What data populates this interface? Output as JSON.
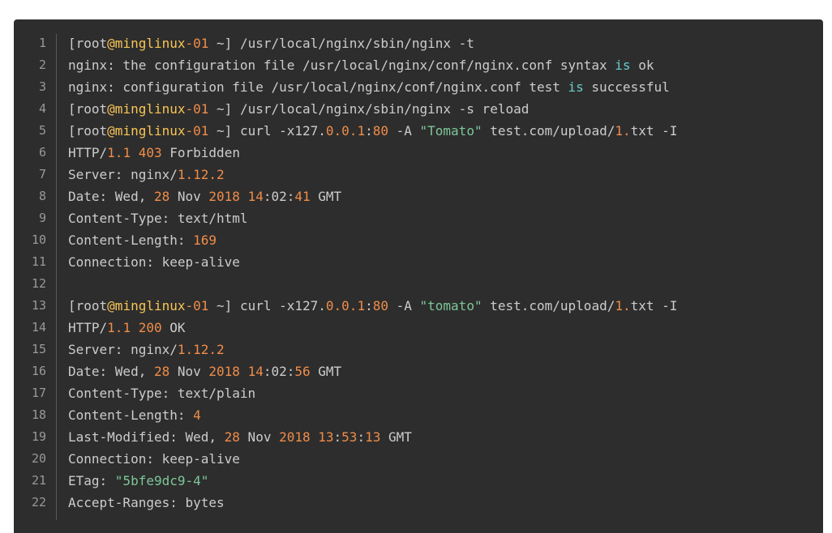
{
  "colors": {
    "background": "#2d2d2d",
    "default_text": "#cccccc",
    "line_number": "#999999",
    "number": "#f08d49",
    "string": "#7ec699",
    "at_symbol": "#f8c555",
    "keyword_is": "#67cdcc"
  },
  "code": {
    "lines": [
      {
        "n": "1",
        "tokens": [
          [
            "[root",
            "d"
          ],
          [
            "@minglinux",
            "a"
          ],
          [
            "-01",
            "p"
          ],
          [
            " ~] /usr/local/nginx/sbin/nginx -t",
            "d"
          ]
        ]
      },
      {
        "n": "2",
        "tokens": [
          [
            "nginx: the configuration file /usr/local/nginx/conf/nginx.conf syntax ",
            "d"
          ],
          [
            "is",
            "c"
          ],
          [
            " ok",
            "d"
          ]
        ]
      },
      {
        "n": "3",
        "tokens": [
          [
            "nginx: configuration file /usr/local/nginx/conf/nginx.conf test ",
            "d"
          ],
          [
            "is",
            "c"
          ],
          [
            " successful",
            "d"
          ]
        ]
      },
      {
        "n": "4",
        "tokens": [
          [
            "[root",
            "d"
          ],
          [
            "@minglinux",
            "a"
          ],
          [
            "-01",
            "p"
          ],
          [
            " ~] /usr/local/nginx/sbin/nginx -s reload",
            "d"
          ]
        ]
      },
      {
        "n": "5",
        "tokens": [
          [
            "[root",
            "d"
          ],
          [
            "@minglinux",
            "a"
          ],
          [
            "-01",
            "p"
          ],
          [
            " ~] curl -x127.",
            "d"
          ],
          [
            "0.0.1",
            "p"
          ],
          [
            ":",
            "d"
          ],
          [
            "80",
            "p"
          ],
          [
            " -A ",
            "d"
          ],
          [
            "\"Tomato\"",
            "s"
          ],
          [
            " test.com/upload/",
            "d"
          ],
          [
            "1.",
            "p"
          ],
          [
            "txt -I",
            "d"
          ]
        ]
      },
      {
        "n": "6",
        "tokens": [
          [
            "HTTP/",
            "d"
          ],
          [
            "1.1",
            "p"
          ],
          [
            " ",
            "d"
          ],
          [
            "403",
            "p"
          ],
          [
            " Forbidden",
            "d"
          ]
        ]
      },
      {
        "n": "7",
        "tokens": [
          [
            "Server: nginx/",
            "d"
          ],
          [
            "1.12.2",
            "p"
          ]
        ]
      },
      {
        "n": "8",
        "tokens": [
          [
            "Date: Wed, ",
            "d"
          ],
          [
            "28",
            "p"
          ],
          [
            " Nov ",
            "d"
          ],
          [
            "2018",
            "p"
          ],
          [
            " ",
            "d"
          ],
          [
            "14",
            "p"
          ],
          [
            ":02:",
            "d"
          ],
          [
            "41",
            "p"
          ],
          [
            " GMT",
            "d"
          ]
        ]
      },
      {
        "n": "9",
        "tokens": [
          [
            "Content-Type: text/html",
            "d"
          ]
        ]
      },
      {
        "n": "10",
        "tokens": [
          [
            "Content-Length: ",
            "d"
          ],
          [
            "169",
            "p"
          ]
        ]
      },
      {
        "n": "11",
        "tokens": [
          [
            "Connection: keep-alive",
            "d"
          ]
        ]
      },
      {
        "n": "12",
        "tokens": []
      },
      {
        "n": "13",
        "tokens": [
          [
            "[root",
            "d"
          ],
          [
            "@minglinux",
            "a"
          ],
          [
            "-01",
            "p"
          ],
          [
            " ~] curl -x127.",
            "d"
          ],
          [
            "0.0.1",
            "p"
          ],
          [
            ":",
            "d"
          ],
          [
            "80",
            "p"
          ],
          [
            " -A ",
            "d"
          ],
          [
            "\"tomato\"",
            "s"
          ],
          [
            " test.com/upload/",
            "d"
          ],
          [
            "1.",
            "p"
          ],
          [
            "txt -I",
            "d"
          ]
        ]
      },
      {
        "n": "14",
        "tokens": [
          [
            "HTTP/",
            "d"
          ],
          [
            "1.1",
            "p"
          ],
          [
            " ",
            "d"
          ],
          [
            "200",
            "p"
          ],
          [
            " OK",
            "d"
          ]
        ]
      },
      {
        "n": "15",
        "tokens": [
          [
            "Server: nginx/",
            "d"
          ],
          [
            "1.12.2",
            "p"
          ]
        ]
      },
      {
        "n": "16",
        "tokens": [
          [
            "Date: Wed, ",
            "d"
          ],
          [
            "28",
            "p"
          ],
          [
            " Nov ",
            "d"
          ],
          [
            "2018",
            "p"
          ],
          [
            " ",
            "d"
          ],
          [
            "14",
            "p"
          ],
          [
            ":02:",
            "d"
          ],
          [
            "56",
            "p"
          ],
          [
            " GMT",
            "d"
          ]
        ]
      },
      {
        "n": "17",
        "tokens": [
          [
            "Content-Type: text/plain",
            "d"
          ]
        ]
      },
      {
        "n": "18",
        "tokens": [
          [
            "Content-Length: ",
            "d"
          ],
          [
            "4",
            "p"
          ]
        ]
      },
      {
        "n": "19",
        "tokens": [
          [
            "Last-Modified: Wed, ",
            "d"
          ],
          [
            "28",
            "p"
          ],
          [
            " Nov ",
            "d"
          ],
          [
            "2018",
            "p"
          ],
          [
            " ",
            "d"
          ],
          [
            "13",
            "p"
          ],
          [
            ":",
            "d"
          ],
          [
            "53",
            "p"
          ],
          [
            ":",
            "d"
          ],
          [
            "13",
            "p"
          ],
          [
            " GMT",
            "d"
          ]
        ]
      },
      {
        "n": "20",
        "tokens": [
          [
            "Connection: keep-alive",
            "d"
          ]
        ]
      },
      {
        "n": "21",
        "tokens": [
          [
            "ETag: ",
            "d"
          ],
          [
            "\"5bfe9dc9-4\"",
            "s"
          ]
        ]
      },
      {
        "n": "22",
        "tokens": [
          [
            "Accept-Ranges: bytes",
            "d"
          ]
        ]
      }
    ]
  }
}
